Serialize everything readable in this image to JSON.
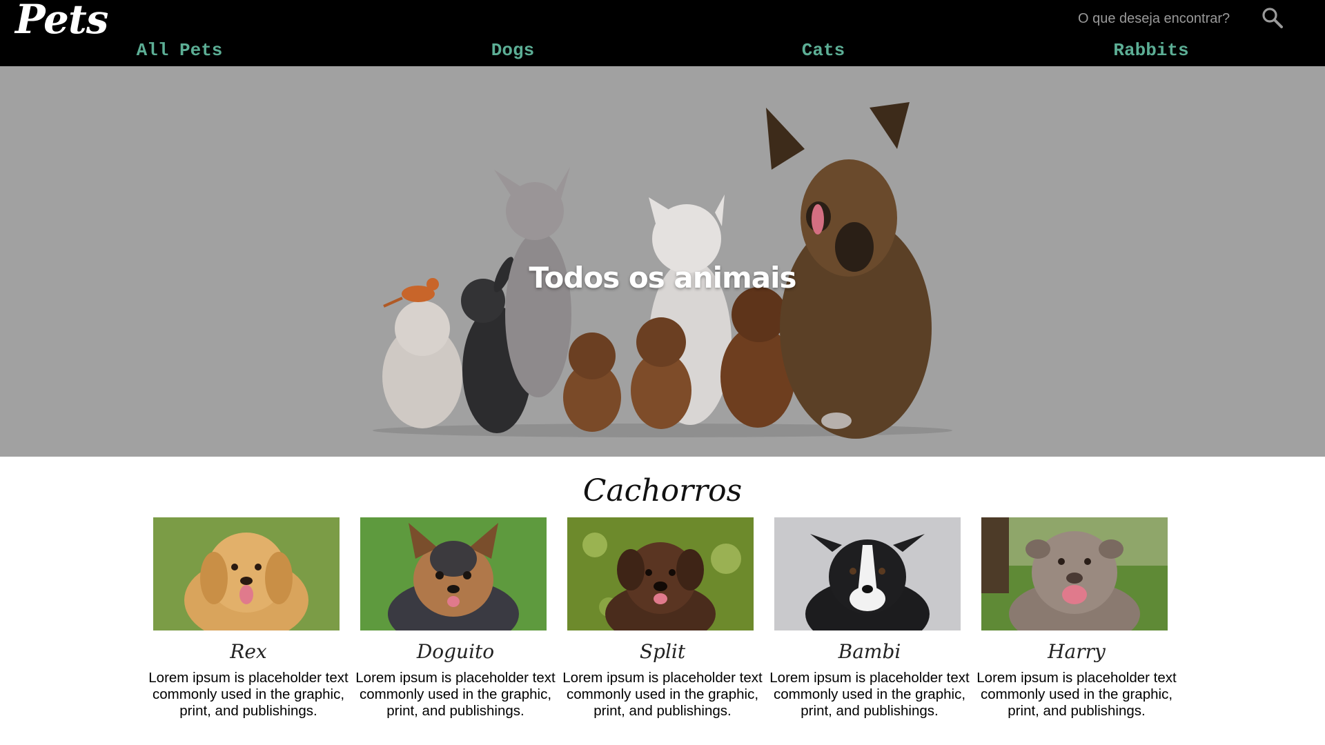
{
  "header": {
    "logo": "Pets",
    "search_placeholder": "O que deseja encontrar?",
    "search_icon": "search-icon",
    "nav": [
      {
        "label": "All Pets"
      },
      {
        "label": "Dogs"
      },
      {
        "label": "Cats"
      },
      {
        "label": "Rabbits"
      }
    ]
  },
  "hero": {
    "title": "Todos os animais"
  },
  "section": {
    "title": "Cachorros",
    "cards": [
      {
        "name": "Rex",
        "description": "Lorem ipsum is placeholder text commonly used in the graphic, print, and publishings."
      },
      {
        "name": "Doguito",
        "description": "Lorem ipsum is placeholder text commonly used in the graphic, print, and publishings."
      },
      {
        "name": "Split",
        "description": "Lorem ipsum is placeholder text commonly used in the graphic, print, and publishings."
      },
      {
        "name": "Bambi",
        "description": "Lorem ipsum is placeholder text commonly used in the graphic, print, and publishings."
      },
      {
        "name": "Harry",
        "description": "Lorem ipsum is placeholder text commonly used in the graphic, print, and publishings."
      }
    ]
  },
  "colors": {
    "nav_text": "#5cae95",
    "header_bg": "#000000",
    "hero_bg": "#a1a1a1"
  }
}
